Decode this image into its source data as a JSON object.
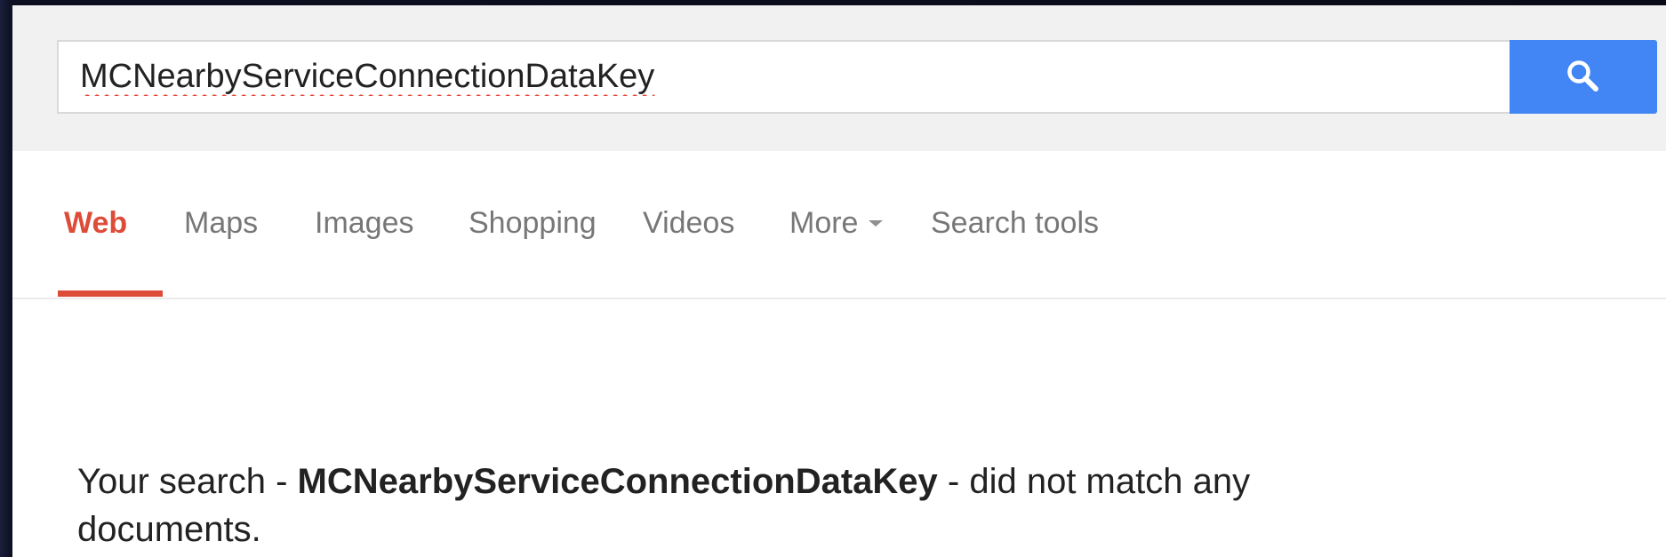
{
  "search": {
    "query": "MCNearbyServiceConnectionDataKey",
    "button_icon": "magnifier-icon"
  },
  "tabs": {
    "web": "Web",
    "maps": "Maps",
    "images": "Images",
    "shopping": "Shopping",
    "videos": "Videos",
    "more": "More",
    "search_tools": "Search tools",
    "active": "Web"
  },
  "results": {
    "prefix": "Your search - ",
    "query": "MCNearbyServiceConnectionDataKey",
    "suffix": " - did not match any documents."
  },
  "colors": {
    "accent_red": "#dd4b39",
    "search_button_blue": "#4285f4",
    "tab_gray": "#777777",
    "header_band": "#f1f1f1"
  }
}
